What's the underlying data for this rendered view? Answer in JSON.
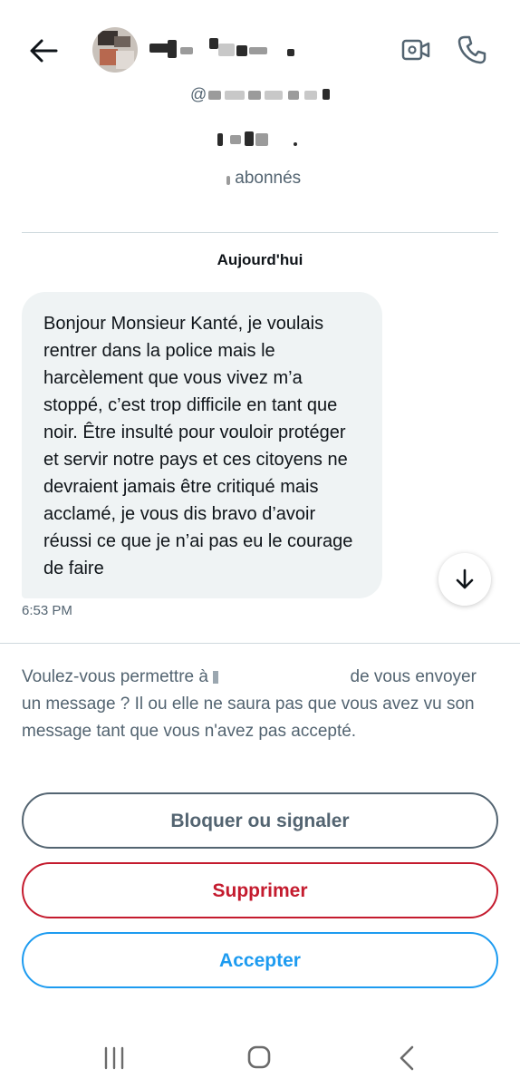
{
  "header": {
    "back_icon": "arrow-left-icon",
    "video_icon": "video-camera-icon",
    "call_icon": "phone-icon"
  },
  "profile": {
    "followers_label": "abonnés"
  },
  "conversation": {
    "date_separator": "Aujourd'hui",
    "messages": [
      {
        "text": "Bonjour Monsieur Kanté, je voulais rentrer dans la police mais le harcèlement que vous vivez m’a stoppé, c’est trop difficile en tant que noir. Être insulté pour vouloir protéger et servir notre pays et ces citoyens ne devraient jamais être critiqué mais acclamé, je vous dis bravo d’avoir réussi ce que je n’ai pas eu le courage de faire",
        "time": "6:53 PM"
      }
    ],
    "scroll_icon": "arrow-down-icon"
  },
  "request": {
    "text_before": "Voulez-vous permettre à",
    "text_after": "de vous envoyer un message ? Il ou elle ne saura pas que vous avez vu son message tant que vous n'avez pas accepté.",
    "block_label": "Bloquer ou signaler",
    "delete_label": "Supprimer",
    "accept_label": "Accepter"
  },
  "colors": {
    "text_primary": "#0f1419",
    "text_secondary": "#536471",
    "bubble_bg": "#eff3f4",
    "danger": "#c41b2e",
    "accent": "#1d9bf0",
    "divider": "#cfd9de"
  },
  "system_nav": {
    "recents_icon": "recents-icon",
    "home_icon": "home-icon",
    "back_icon": "system-back-icon"
  }
}
